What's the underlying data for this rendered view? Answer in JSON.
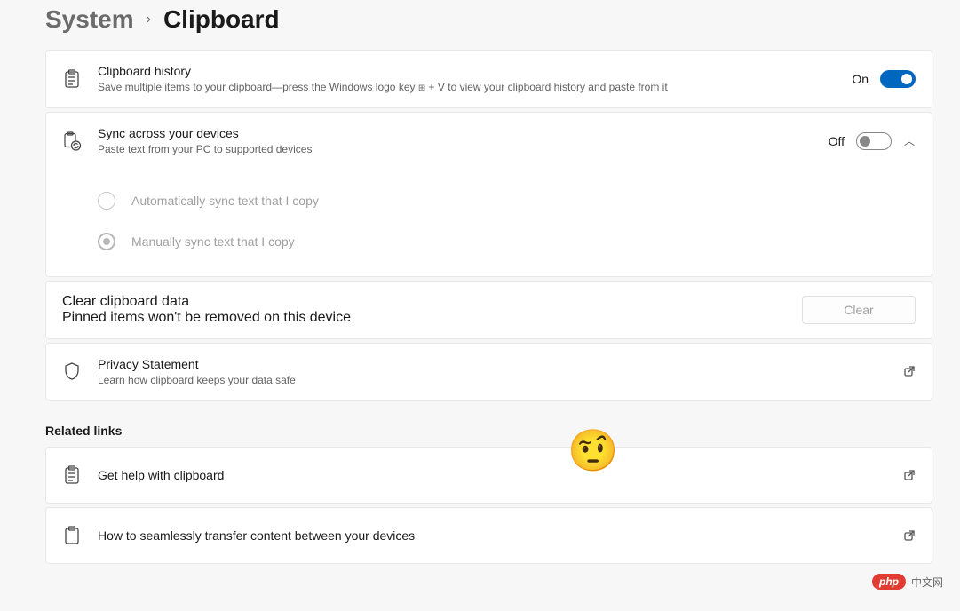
{
  "breadcrumb": {
    "parent": "System",
    "chevron": "›",
    "current": "Clipboard"
  },
  "cards": {
    "history": {
      "title": "Clipboard history",
      "sub_prefix": "Save multiple items to your clipboard—press the Windows logo key ",
      "sub_suffix": " + V to view your clipboard history and paste from it",
      "state_label": "On"
    },
    "sync": {
      "title": "Sync across your devices",
      "sub": "Paste text from your PC to supported devices",
      "state_label": "Off"
    },
    "sync_options": {
      "auto": "Automatically sync text that I copy",
      "manual": "Manually sync text that I copy"
    },
    "clear": {
      "title": "Clear clipboard data",
      "sub": "Pinned items won't be removed on this device",
      "button": "Clear"
    },
    "privacy": {
      "title": "Privacy Statement",
      "sub": "Learn how clipboard keeps your data safe"
    }
  },
  "related": {
    "heading": "Related links",
    "help": "Get help with clipboard",
    "transfer": "How to seamlessly transfer content between your devices"
  },
  "watermark": {
    "pill": "php",
    "text": "中文网"
  }
}
